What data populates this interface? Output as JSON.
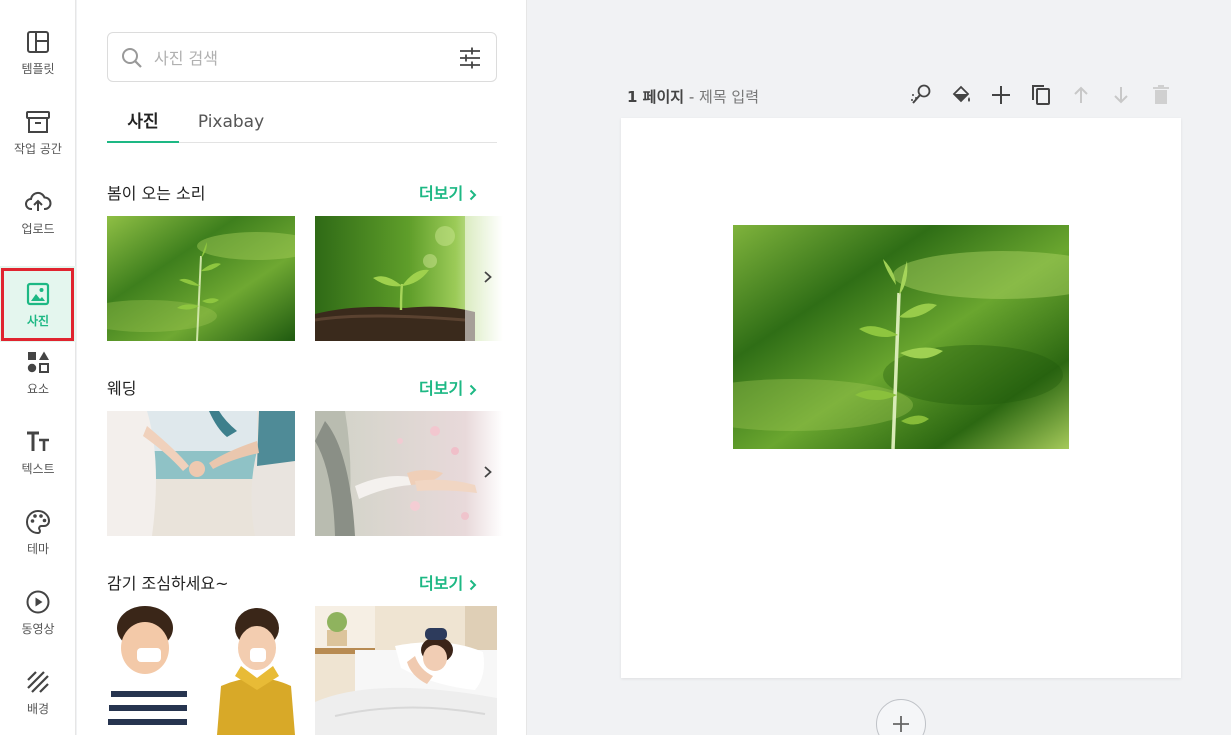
{
  "nav": {
    "items": [
      {
        "label": "템플릿",
        "icon": "layout-icon"
      },
      {
        "label": "작업 공간",
        "icon": "archive-box-icon"
      },
      {
        "label": "업로드",
        "icon": "cloud-upload-icon"
      },
      {
        "label": "사진",
        "icon": "image-icon"
      },
      {
        "label": "요소",
        "icon": "shapes-icon"
      },
      {
        "label": "텍스트",
        "icon": "text-icon"
      },
      {
        "label": "테마",
        "icon": "palette-icon"
      },
      {
        "label": "동영상",
        "icon": "play-circle-icon"
      },
      {
        "label": "배경",
        "icon": "stripes-icon"
      }
    ],
    "active": "사진"
  },
  "panel": {
    "search_placeholder": "사진 검색",
    "tabs": [
      "사진",
      "Pixabay"
    ],
    "sections": [
      {
        "title": "봄이 오는 소리",
        "more": "더보기"
      },
      {
        "title": "웨딩",
        "more": "더보기"
      },
      {
        "title": "감기 조심하세요~",
        "more": "더보기"
      }
    ]
  },
  "canvas": {
    "page_number": "1 페이지",
    "separator": "-",
    "title_placeholder": "제목 입력",
    "toolbar": [
      "magic-wand-icon",
      "paint-bucket-icon",
      "plus-icon",
      "duplicate-icon",
      "arrow-up-icon",
      "arrow-down-icon",
      "trash-icon"
    ]
  },
  "colors": {
    "accent": "#1db884",
    "active_bg": "#e4f6ee",
    "highlight_outline": "#e0242f"
  }
}
